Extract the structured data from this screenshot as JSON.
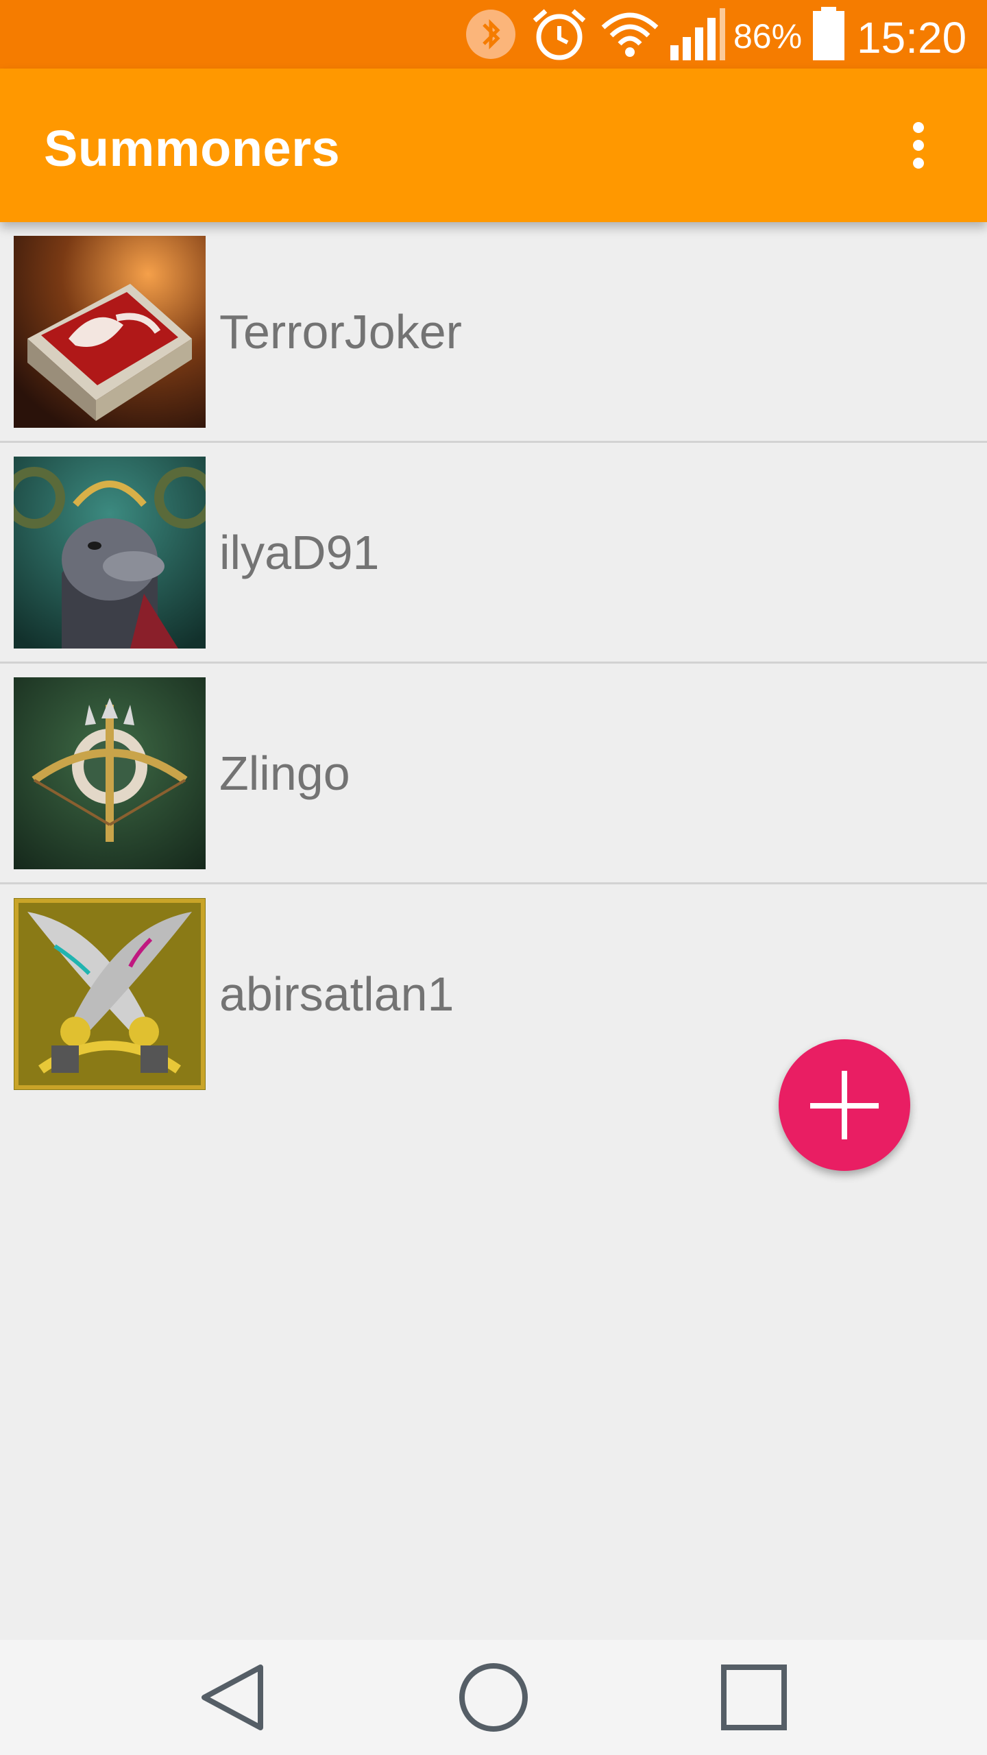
{
  "status_bar": {
    "icons": [
      "bluetooth-icon",
      "alarm-icon",
      "wifi-icon",
      "signal-icon",
      "battery-icon"
    ],
    "battery_percent": "86%",
    "time": "15:20"
  },
  "app_bar": {
    "title": "Summoners",
    "menu_icon": "more-vert-icon"
  },
  "summoners": [
    {
      "name": "TerrorJoker",
      "avatar_icon": "spellbook-icon"
    },
    {
      "name": "ilyaD91",
      "avatar_icon": "laurel-creature-icon"
    },
    {
      "name": "Zlingo",
      "avatar_icon": "crossbow-icon"
    },
    {
      "name": "abirsatlan1",
      "avatar_icon": "crossed-blades-icon"
    }
  ],
  "fab": {
    "icon": "plus-icon"
  },
  "nav_bar": {
    "icons": [
      "back-icon",
      "home-icon",
      "recents-icon"
    ]
  },
  "colors": {
    "status_bar": "#f57c00",
    "app_bar": "#ff9800",
    "fab": "#e91e63",
    "background": "#eeeeee",
    "name_text": "#737373"
  }
}
